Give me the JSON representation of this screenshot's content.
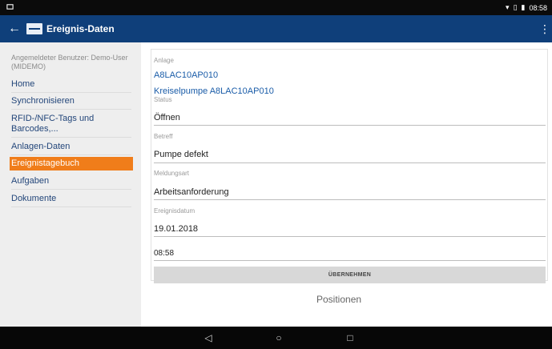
{
  "statusbar": {
    "time": "08:58"
  },
  "appbar": {
    "title": "Ereignis-Daten"
  },
  "sidebar": {
    "user_label": "Angemeldeter Benutzer: Demo-User (MIDEMO)",
    "items": [
      {
        "label": "Home"
      },
      {
        "label": "Synchronisieren"
      },
      {
        "label": "RFID-/NFC-Tags und Barcodes,..."
      },
      {
        "label": "Anlagen-Daten"
      },
      {
        "label": "Ereignistagebuch",
        "active": true
      },
      {
        "label": "Aufgaben"
      },
      {
        "label": "Dokumente"
      }
    ]
  },
  "form": {
    "anlage_label": "Anlage",
    "anlage_code": "A8LAC10AP010",
    "anlage_name": "Kreiselpumpe A8LAC10AP010",
    "status_label": "Status",
    "status_value": "Öffnen",
    "betreff_label": "Betreff",
    "betreff_value": "Pumpe defekt",
    "meldungsart_label": "Meldungsart",
    "meldungsart_value": "Arbeitsanforderung",
    "ereignisdatum_label": "Ereignisdatum",
    "date_value": "19.01.2018",
    "time_value": "08:58",
    "submit_label": "ÜBERNEHMEN"
  },
  "positions_label": "Positionen",
  "colors": {
    "appbar": "#0f3f7a",
    "accent": "#f07d1a",
    "link": "#1a5ca8"
  }
}
